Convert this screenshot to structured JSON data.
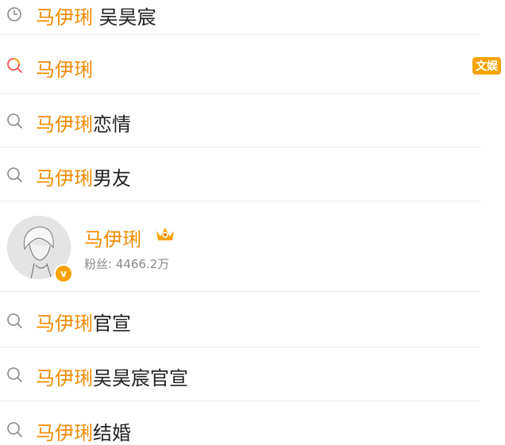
{
  "rows": [
    {
      "highlight": "马伊琍",
      "rest": " 吴昊宸",
      "icon": "history-clock-icon"
    },
    {
      "highlight": "马伊琍",
      "rest": "",
      "icon": "hot-search-icon",
      "badge": "文娱"
    },
    {
      "highlight": "马伊琍",
      "rest": "恋情",
      "icon": "search-icon"
    },
    {
      "highlight": "马伊琍",
      "rest": "男友",
      "icon": "search-icon"
    },
    {
      "highlight": "马伊琍",
      "rest": "官宣",
      "icon": "search-icon"
    },
    {
      "highlight": "马伊琍",
      "rest": "吴昊宸官宣",
      "icon": "search-icon"
    },
    {
      "highlight": "马伊琍",
      "rest": "结婚",
      "icon": "search-icon"
    }
  ],
  "user": {
    "name": "马伊琍",
    "fans_label": "粉丝: 4466.2万",
    "verified_glyph": "v",
    "crown_icon": "vip-crown-icon"
  },
  "colors": {
    "accent": "#f08a00",
    "badge": "#f5a300",
    "text": "#222222",
    "muted": "#888888",
    "divider": "#ececec"
  }
}
